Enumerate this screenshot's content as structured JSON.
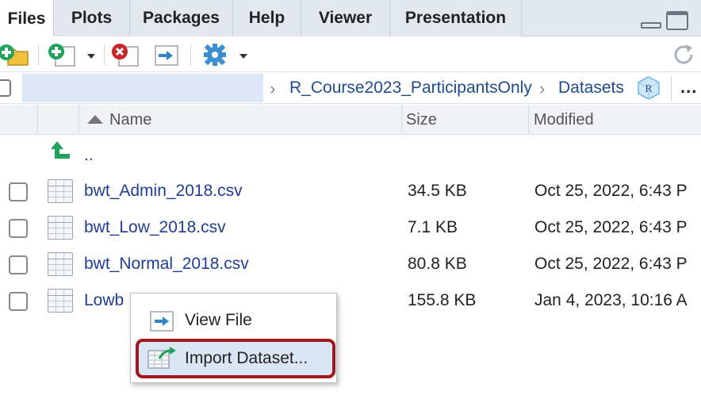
{
  "tabs": [
    {
      "label": "Files",
      "active": true
    },
    {
      "label": "Plots",
      "active": false
    },
    {
      "label": "Packages",
      "active": false
    },
    {
      "label": "Help",
      "active": false
    },
    {
      "label": "Viewer",
      "active": false
    },
    {
      "label": "Presentation",
      "active": false
    }
  ],
  "breadcrumb": {
    "items": [
      "R_Course2023_ParticipantsOnly",
      "Datasets"
    ],
    "more": "..."
  },
  "table": {
    "columns": [
      "Name",
      "Size",
      "Modified"
    ],
    "parent_label": "..",
    "rows": [
      {
        "name": "bwt_Admin_2018.csv",
        "size": "34.5 KB",
        "modified": "Oct 25, 2022, 6:43 P"
      },
      {
        "name": "bwt_Low_2018.csv",
        "size": "7.1 KB",
        "modified": "Oct 25, 2022, 6:43 P"
      },
      {
        "name": "bwt_Normal_2018.csv",
        "size": "80.8 KB",
        "modified": "Oct 25, 2022, 6:43 P"
      },
      {
        "name": "Lowb",
        "size": "155.8 KB",
        "modified": "Jan 4, 2023, 10:16 A"
      }
    ]
  },
  "context_menu": {
    "items": [
      {
        "label": "View File"
      },
      {
        "label": "Import Dataset..."
      }
    ]
  },
  "colors": {
    "highlight_ring": "#a3161a",
    "link": "#1f3d95",
    "green_icon": "#1fa35a",
    "red_icon": "#c8262b",
    "blue_icon": "#2f86c9"
  }
}
